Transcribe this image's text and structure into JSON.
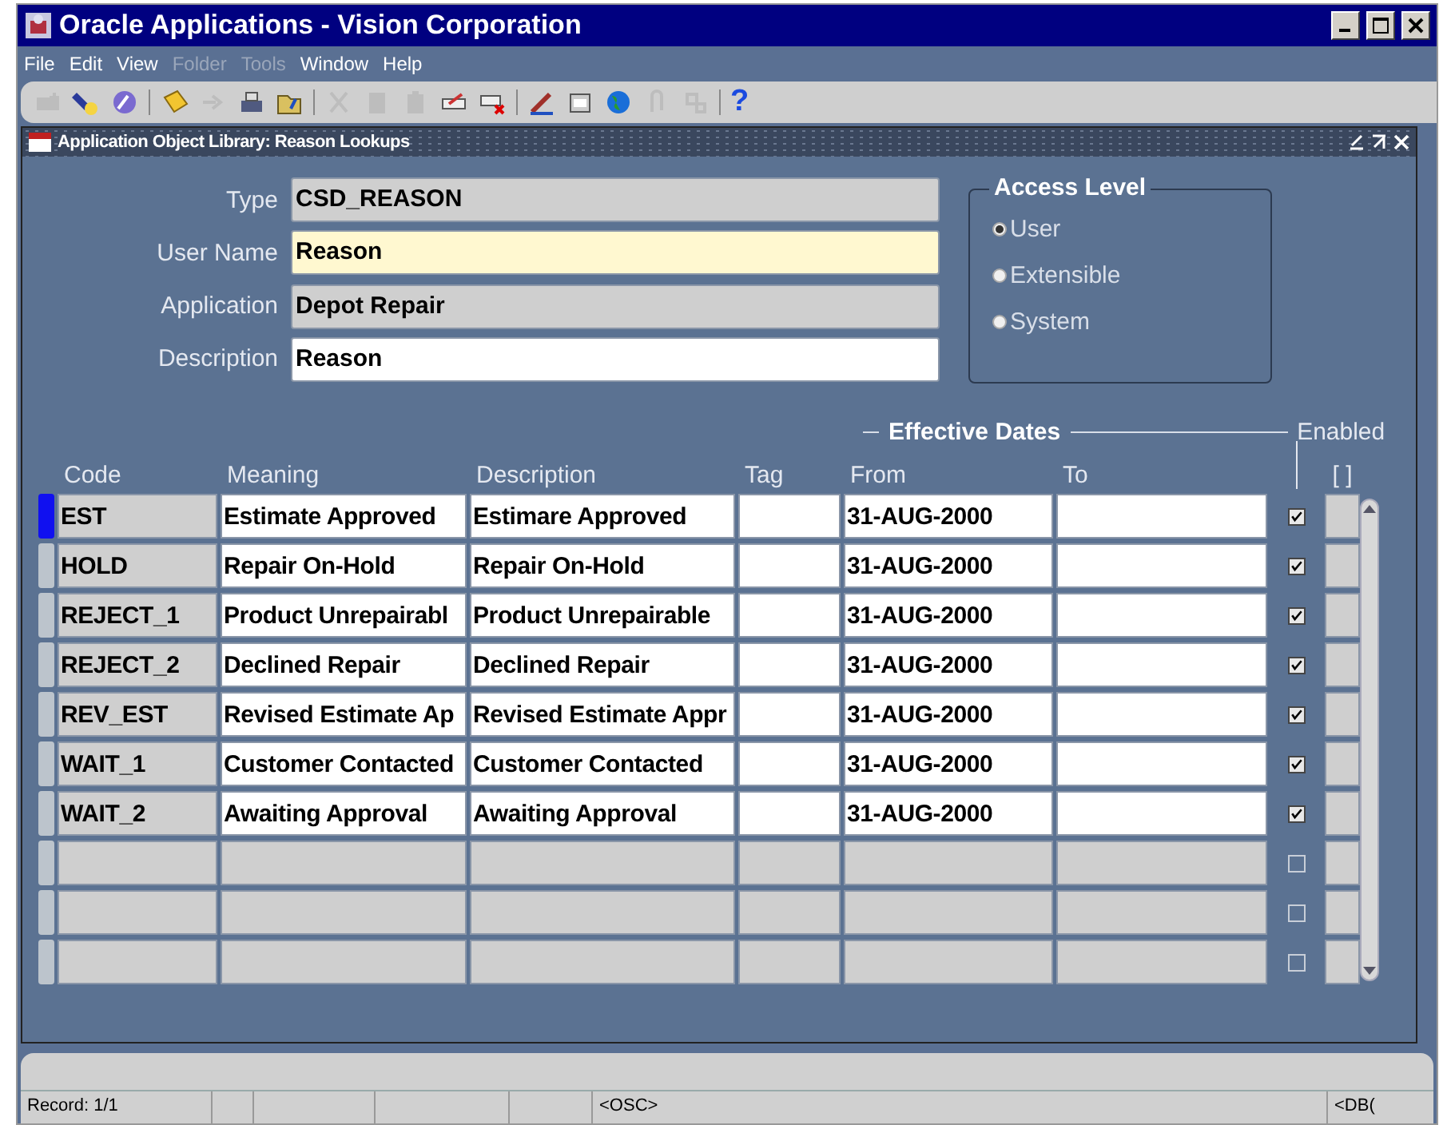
{
  "window": {
    "title": "Oracle Applications - Vision Corporation"
  },
  "menu": [
    {
      "label": "File",
      "disabled": false
    },
    {
      "label": "Edit",
      "disabled": false
    },
    {
      "label": "View",
      "disabled": false
    },
    {
      "label": "Folder",
      "disabled": true
    },
    {
      "label": "Tools",
      "disabled": true
    },
    {
      "label": "Window",
      "disabled": false
    },
    {
      "label": "Help",
      "disabled": false
    }
  ],
  "toolbar": [
    {
      "kind": "icon",
      "disabled": true
    },
    {
      "kind": "icon",
      "disabled": false
    },
    {
      "kind": "icon",
      "disabled": false
    },
    {
      "kind": "separator"
    },
    {
      "kind": "icon",
      "disabled": false
    },
    {
      "kind": "icon",
      "disabled": true
    },
    {
      "kind": "icon",
      "disabled": false
    },
    {
      "kind": "icon",
      "disabled": false
    },
    {
      "kind": "separator"
    },
    {
      "kind": "icon",
      "disabled": true
    },
    {
      "kind": "icon",
      "disabled": true
    },
    {
      "kind": "icon",
      "disabled": true
    },
    {
      "kind": "icon",
      "disabled": false
    },
    {
      "kind": "icon",
      "disabled": false
    },
    {
      "kind": "separator"
    },
    {
      "kind": "icon",
      "disabled": false
    },
    {
      "kind": "icon",
      "disabled": false
    },
    {
      "kind": "icon",
      "disabled": false
    },
    {
      "kind": "icon",
      "disabled": true
    },
    {
      "kind": "icon",
      "disabled": true
    },
    {
      "kind": "separator"
    },
    {
      "kind": "help",
      "label": "?"
    }
  ],
  "form": {
    "title": "Application Object Library: Reason Lookups",
    "fields": [
      {
        "label": "Type",
        "value": "CSD_REASON",
        "kind": "readonly"
      },
      {
        "label": "User Name",
        "value": "Reason",
        "kind": "required"
      },
      {
        "label": "Application",
        "value": "Depot Repair",
        "kind": "readonly"
      },
      {
        "label": "Description",
        "value": "Reason",
        "kind": "optional"
      }
    ],
    "access_level": {
      "title": "Access Level",
      "options": [
        {
          "label": "User",
          "selected": true
        },
        {
          "label": "Extensible",
          "selected": false
        },
        {
          "label": "System",
          "selected": false
        }
      ]
    }
  },
  "table": {
    "group_label": "Effective Dates",
    "enabled_label": "Enabled",
    "columns": [
      "Code",
      "Meaning",
      "Description",
      "Tag",
      "From",
      "To"
    ],
    "extra_column": "[ ]",
    "rows": [
      {
        "kind": "record",
        "selected": true,
        "code": "EST",
        "meaning": "Estimate Approved",
        "description": "Estimare Approved",
        "from": "31-AUG-2000",
        "enabled": true
      },
      {
        "kind": "record",
        "selected": false,
        "code": "HOLD",
        "meaning": "Repair On-Hold",
        "description": "Repair On-Hold",
        "from": "31-AUG-2000",
        "enabled": true
      },
      {
        "kind": "record",
        "selected": false,
        "code": "REJECT_1",
        "meaning": "Product Unrepairabl",
        "description": "Product Unrepairable",
        "from": "31-AUG-2000",
        "enabled": true
      },
      {
        "kind": "record",
        "selected": false,
        "code": "REJECT_2",
        "meaning": "Declined Repair",
        "description": "Declined Repair",
        "from": "31-AUG-2000",
        "enabled": true
      },
      {
        "kind": "record",
        "selected": false,
        "code": "REV_EST",
        "meaning": "Revised Estimate Ap",
        "description": "Revised Estimate Appr",
        "from": "31-AUG-2000",
        "enabled": true
      },
      {
        "kind": "record",
        "selected": false,
        "code": "WAIT_1",
        "meaning": "Customer Contacted",
        "description": "Customer Contacted",
        "from": "31-AUG-2000",
        "enabled": true
      },
      {
        "kind": "record",
        "selected": false,
        "code": "WAIT_2",
        "meaning": "Awaiting Approval",
        "description": "Awaiting Approval",
        "from": "31-AUG-2000",
        "enabled": true
      },
      {
        "kind": "empty",
        "selected": false,
        "enabled": false
      },
      {
        "kind": "empty",
        "selected": false,
        "enabled": false
      },
      {
        "kind": "empty",
        "selected": false,
        "enabled": false
      }
    ]
  },
  "status_bar": {
    "record": "Record: 1/1",
    "mode": "<OSC>",
    "database": "<DB("
  }
}
